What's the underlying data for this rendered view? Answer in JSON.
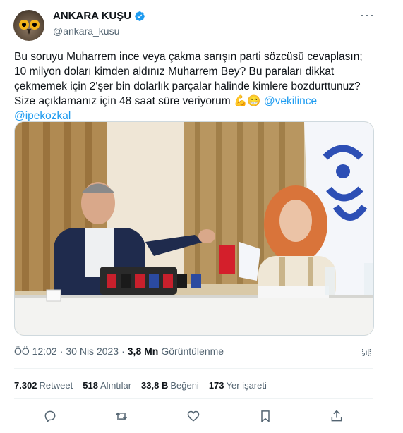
{
  "tweet": {
    "author_name": "ANKARA KUŞU",
    "author_handle": "@ankara_kusu",
    "text_plain": "Bu soruyu Muharrem ince veya çakma sarışın parti sözcüsü cevaplasın; 10 milyon doları kimden aldınız Muharrem Bey? Bu paraları dikkat çekmemek için 2'şer bin dolarlık parçalar halinde kimlere bozdurttunuz? Size açıklamanız için 48 saat süre veriyorum 💪😁 ",
    "mention_1": "@vekilince",
    "mention_2": "@ipekozkal",
    "time": "ÖÖ 12:02",
    "separator": "·",
    "date": "30 Nis 2023",
    "views_count": "3,8 Mn",
    "views_label": "Görüntülenme"
  },
  "stats": {
    "retweets_count": "7.302",
    "retweets_label": "Retweet",
    "quotes_count": "518",
    "quotes_label": "Alıntılar",
    "likes_count": "33,8 B",
    "likes_label": "Beğeni",
    "bookmarks_count": "173",
    "bookmarks_label": "Yer işareti"
  },
  "icons": [
    "verified-badge-icon",
    "more-icon",
    "analytics-icon",
    "reply-icon",
    "retweet-icon",
    "like-icon",
    "bookmark-icon",
    "share-icon"
  ],
  "colors": {
    "link": "#1d9bf0",
    "secondary": "#536471",
    "primary_text": "#0f1419"
  }
}
